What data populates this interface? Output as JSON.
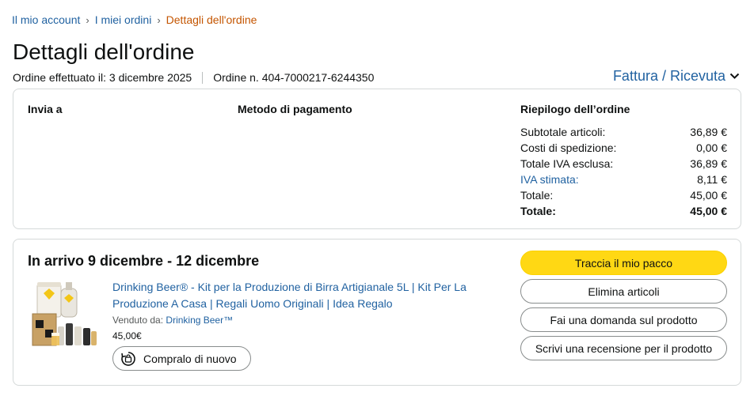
{
  "breadcrumb": {
    "account": "Il mio account",
    "orders": "I miei ordini",
    "current": "Dettagli dell'ordine",
    "separator": "›"
  },
  "page": {
    "title": "Dettagli dell'ordine",
    "order_date": "Ordine effettuato il: 3 dicembre 2025",
    "order_number": "Ordine n. 404-7000217-6244350",
    "invoice_link": "Fattura / Ricevuta"
  },
  "details": {
    "ship_to_heading": "Invia a",
    "payment_heading": "Metodo di pagamento",
    "summary_heading": "Riepilogo dell’ordine",
    "summary_rows": [
      {
        "label": "Subtotale articoli:",
        "value": "36,89 €"
      },
      {
        "label": "Costi di spedizione:",
        "value": "0,00 €"
      },
      {
        "label": "Totale IVA esclusa:",
        "value": "36,89 €"
      },
      {
        "label": "IVA stimata:",
        "value": "8,11 €"
      },
      {
        "label": "Totale:",
        "value": "45,00 €"
      },
      {
        "label": "Totale:",
        "value": "45,00 €"
      }
    ]
  },
  "shipment": {
    "delivery_title": "In arrivo 9 dicembre - 12 dicembre",
    "product_title": "Drinking Beer® - Kit per la Produzione di Birra Artigianale 5L | Kit Per La Produzione A Casa | Regali Uomo Originali | Idea Regalo",
    "seller_label": "Venduto da:",
    "seller_name": "Drinking Beer™",
    "price": "45,00€",
    "buy_again": "Compralo di nuovo",
    "buttons": {
      "track": "Traccia il mio pacco",
      "remove": "Elimina articoli",
      "question": "Fai una domanda sul prodotto",
      "review": "Scrivi una recensione per il prodotto"
    }
  },
  "colors": {
    "link": "#2162a1",
    "breadcrumb_current": "#c45500",
    "primary_button": "#ffd814",
    "border": "#d5d9d9"
  },
  "icons": [
    "chevron-down-icon",
    "buy-again-icon",
    "product-image"
  ]
}
